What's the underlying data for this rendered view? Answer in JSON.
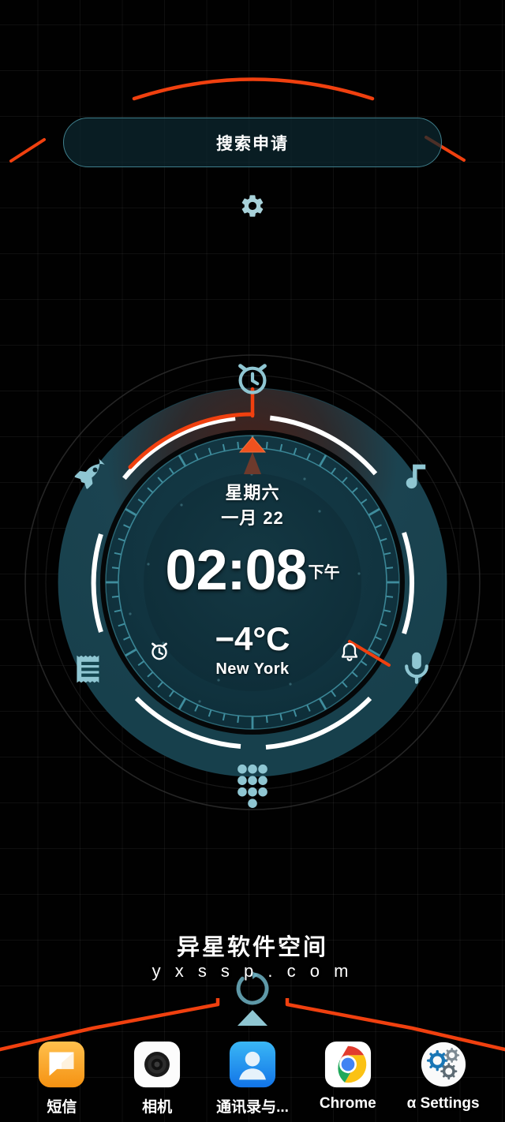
{
  "search": {
    "label": "搜索申请"
  },
  "settings_shortcut": {
    "icon": "gear-icon"
  },
  "clock_widget": {
    "weekday": "星期六",
    "month_day": "一月 22",
    "time": "02:08",
    "ampm": "下午",
    "temperature": "−4°C",
    "city": "New York",
    "ring_icons": [
      {
        "name": "alarm-clock-icon",
        "position": "top"
      },
      {
        "name": "rocket-icon",
        "position": "upper-left"
      },
      {
        "name": "music-note-icon",
        "position": "upper-right"
      },
      {
        "name": "receipt-notes-icon",
        "position": "lower-left"
      },
      {
        "name": "microphone-icon",
        "position": "lower-right"
      },
      {
        "name": "dialpad-icon",
        "position": "bottom"
      }
    ],
    "inner_icons": [
      {
        "name": "alarm-small-icon",
        "position": "inner-left"
      },
      {
        "name": "bell-icon",
        "position": "inner-right"
      }
    ],
    "colors": {
      "ring_fill": "#194450",
      "inner_fill": "#123641",
      "accent_red": "#f03c12",
      "accent_teal": "#8fc6d2",
      "tick_teal": "#4d9aa8",
      "marker_white": "#ffffff"
    }
  },
  "watermark": {
    "line_cn": "异星软件空间",
    "line_en": "y x s s p . c o m"
  },
  "dock": {
    "items": [
      {
        "label": "短信",
        "icon": "messages-icon"
      },
      {
        "label": "相机",
        "icon": "camera-icon"
      },
      {
        "label": "通讯录与...",
        "icon": "contacts-icon"
      },
      {
        "label": "Chrome",
        "icon": "chrome-icon"
      },
      {
        "label": "α Settings",
        "icon": "settings-gears-icon"
      }
    ]
  },
  "home_indicator": {
    "icon": "up-arrow-icon"
  }
}
